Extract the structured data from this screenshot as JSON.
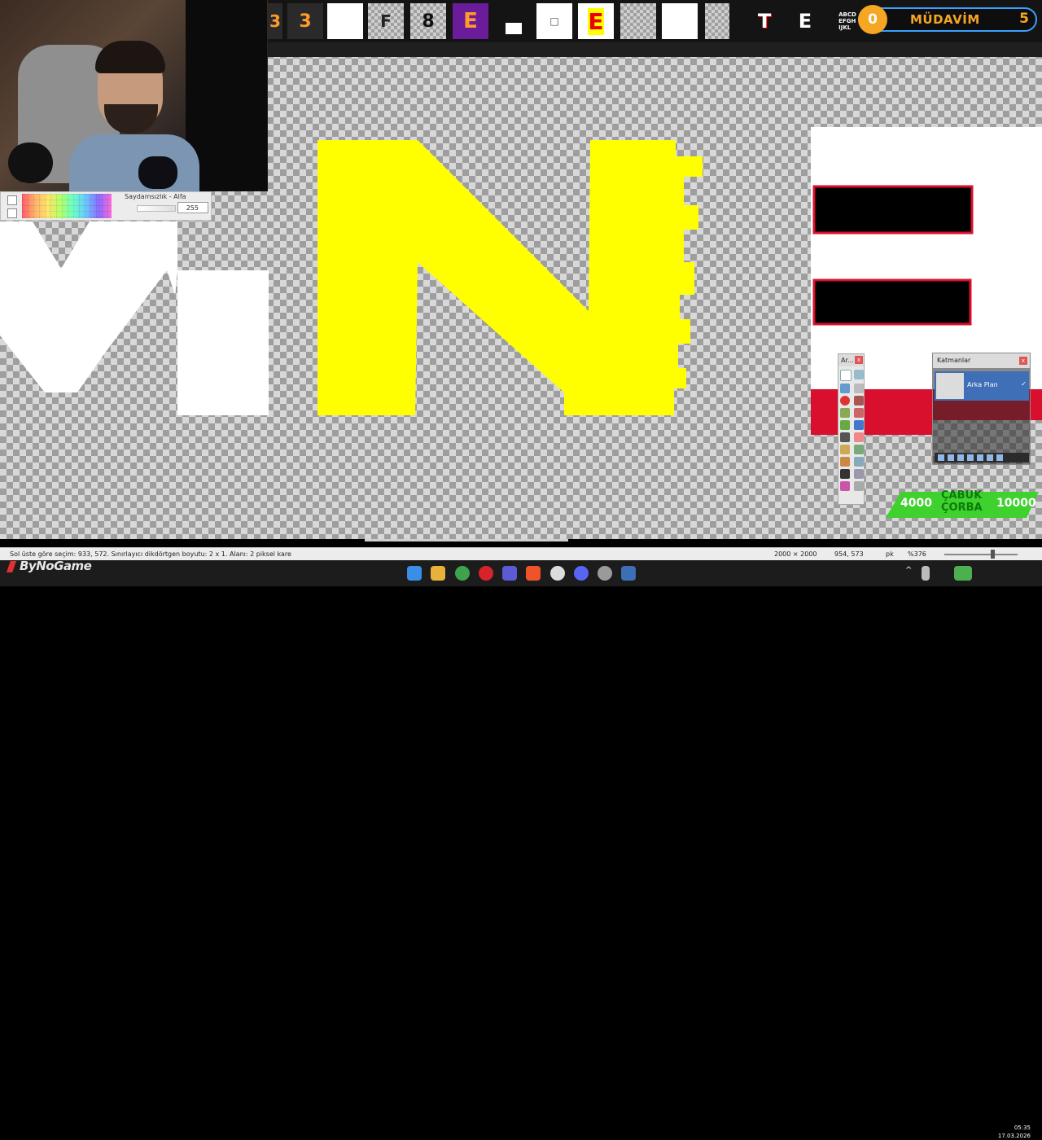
{
  "palette_panel": {
    "alpha_label": "Saydamsızlık - Alfa",
    "alpha_value": "255"
  },
  "tools_panel": {
    "title": "Ar..."
  },
  "layers_panel": {
    "title": "Katmanlar",
    "layer_name": "Arka Plan"
  },
  "overlay": {
    "badge_circle": "0",
    "badge_word": "MÜDAVİM",
    "badge_number": "5",
    "corba_left": "4000",
    "corba_title_line1": "ÇABUK",
    "corba_title_line2": "ÇORBA",
    "corba_right": "10000"
  },
  "statusbar": {
    "selection_text": "Sol üste göre seçim: 933, 572. Sınırlayıcı dikdörtgen boyutu: 2 x 1. Alanı: 2 piksel kare",
    "image_size": "2000 × 2000",
    "cursor_pos": "954, 573",
    "unit": "pk",
    "zoom": "%376"
  },
  "taskbar": {
    "brand": "ByNoGame",
    "time": "05:35",
    "date": "17.03.2026"
  },
  "colors": {
    "yellow": "#ffff00",
    "red": "#d8102e",
    "accent_green": "#3fd12e",
    "badge_orange": "#f5a623"
  }
}
